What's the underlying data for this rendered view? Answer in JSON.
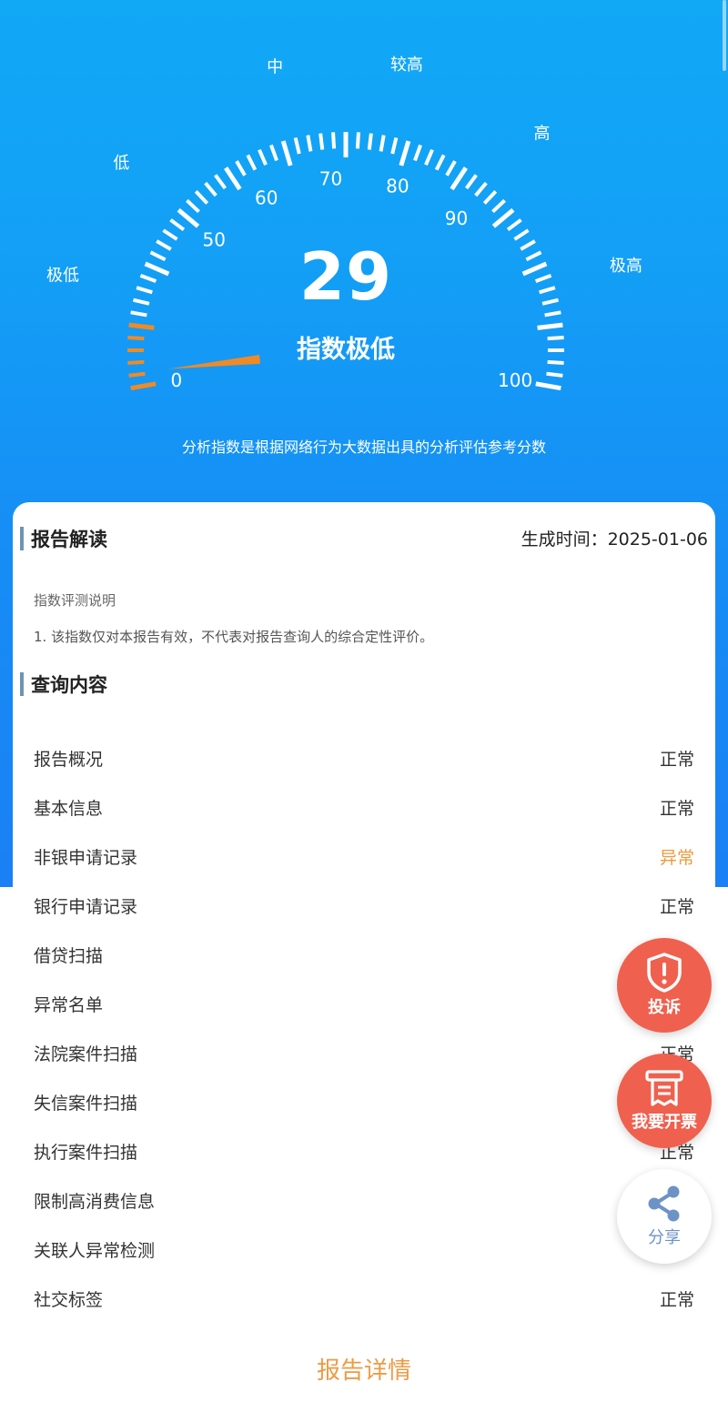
{
  "gauge": {
    "score": "29",
    "score_text": "指数极低",
    "zone_labels": [
      "极低",
      "低",
      "中",
      "较高",
      "高",
      "极高"
    ],
    "tick_labels": [
      "0",
      "50",
      "60",
      "70",
      "80",
      "90",
      "100"
    ],
    "value_fraction": 0.29,
    "accent_color": "#f08a24"
  },
  "hero_note": "分析指数是根据网络行为大数据出具的分析评估参考分数",
  "report": {
    "section_title": "报告解读",
    "generated_label": "生成时间：",
    "generated_value": "2025-01-06",
    "desc_title": "指数评测说明",
    "desc_text": "1. 该指数仅对本报告有效，不代表对报告查询人的综合定性评价。"
  },
  "query": {
    "section_title": "查询内容",
    "items": [
      {
        "name": "报告概况",
        "status": "正常"
      },
      {
        "name": "基本信息",
        "status": "正常"
      },
      {
        "name": "非银申请记录",
        "status": "异常"
      },
      {
        "name": "银行申请记录",
        "status": "正常"
      },
      {
        "name": "借贷扫描",
        "status": ""
      },
      {
        "name": "异常名单",
        "status": ""
      },
      {
        "name": "法院案件扫描",
        "status": "正常"
      },
      {
        "name": "失信案件扫描",
        "status": ""
      },
      {
        "name": "执行案件扫描",
        "status": "正常"
      },
      {
        "name": "限制高消费信息",
        "status": ""
      },
      {
        "name": "关联人异常检测",
        "status": ""
      },
      {
        "name": "社交标签",
        "status": "正常"
      }
    ]
  },
  "detail_link": "报告详情",
  "fabs": {
    "complaint": "投诉",
    "invoice": "我要开票",
    "share": "分享"
  },
  "colors": {
    "abnormal": "#ef9a3b",
    "fab_red": "#f0604e",
    "share_blue": "#6d93c6"
  }
}
